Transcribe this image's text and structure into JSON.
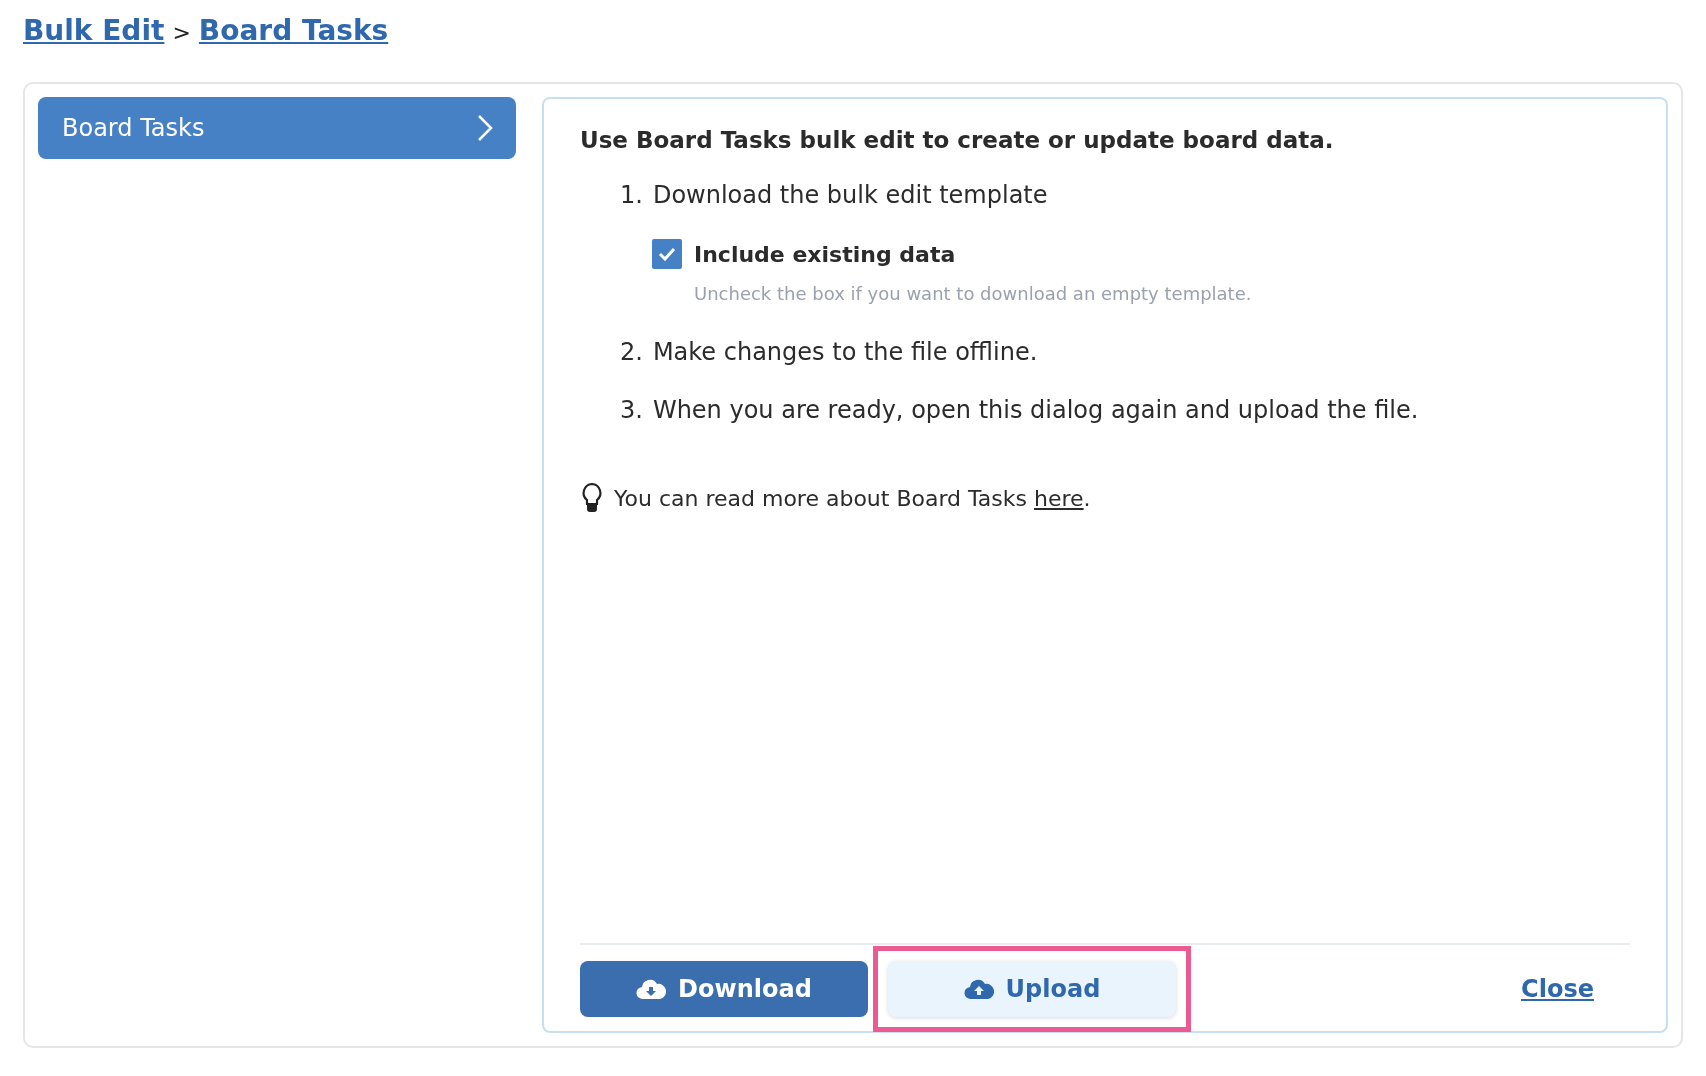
{
  "breadcrumb": [
    {
      "label": "Bulk Edit"
    },
    {
      "label": "Board Tasks"
    }
  ],
  "breadcrumb_separator": ">",
  "sidebar": {
    "items": [
      {
        "label": "Board Tasks",
        "selected": true
      }
    ]
  },
  "panel": {
    "heading": "Use Board Tasks bulk edit to create or update board data.",
    "steps": [
      {
        "number": "1.",
        "text": "Download the bulk edit template",
        "option": {
          "label": "Include existing data",
          "checked": true,
          "hint": "Uncheck the box if you want to download an empty template."
        }
      },
      {
        "number": "2.",
        "text": "Make changes to the file offline."
      },
      {
        "number": "3.",
        "text": "When you are ready, open this dialog again and upload the file."
      }
    ],
    "tip": {
      "text": "You can read more about Board Tasks ",
      "link": "here",
      "end": "."
    },
    "buttons": [
      {
        "label": "Download",
        "kind": "primary",
        "highlighted": false
      },
      {
        "label": "Upload",
        "kind": "secondary",
        "highlighted": true
      },
      {
        "label": "Close",
        "kind": "link",
        "highlighted": false
      }
    ]
  }
}
